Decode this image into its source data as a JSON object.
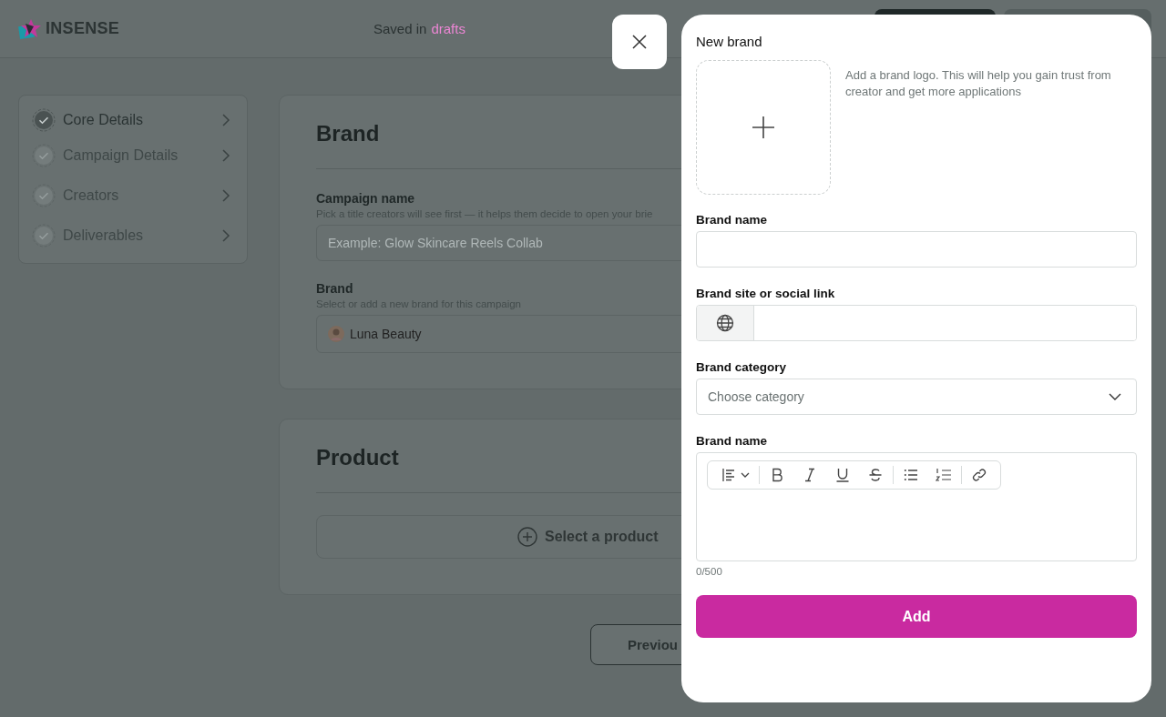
{
  "header": {
    "logo_text": "INSENSE",
    "saved_prefix": "Saved in",
    "saved_link": "drafts"
  },
  "sidebar": {
    "steps": [
      {
        "label": "Core Details",
        "selected": true
      },
      {
        "label": "Campaign Details",
        "selected": false
      },
      {
        "label": "Creators",
        "selected": false
      },
      {
        "label": "Deliverables",
        "selected": false
      }
    ]
  },
  "brand_section": {
    "title": "Brand",
    "campaign_name": {
      "label": "Campaign name",
      "hint": "Pick a title creators will see first — it helps them decide to open your brie",
      "placeholder": "Example: Glow Skincare Reels Collab"
    },
    "brand": {
      "label": "Brand",
      "hint": "Select or add a new brand for this campaign",
      "value": "Luna Beauty"
    }
  },
  "product_section": {
    "title": "Product",
    "select_button": "Select a product"
  },
  "footer": {
    "previous_button": "Previou"
  },
  "modal": {
    "title": "New brand",
    "logo_hint": "Add a brand logo. This will help you gain trust from creator and get more applications",
    "fields": [
      {
        "kind": "text",
        "label": "Brand name"
      },
      {
        "kind": "link",
        "label": "Brand site or social link"
      },
      {
        "kind": "select",
        "label": "Brand category",
        "placeholder": "Choose category"
      },
      {
        "kind": "editor",
        "label": "Brand name",
        "counter": "0/500"
      }
    ],
    "submit": "Add"
  }
}
